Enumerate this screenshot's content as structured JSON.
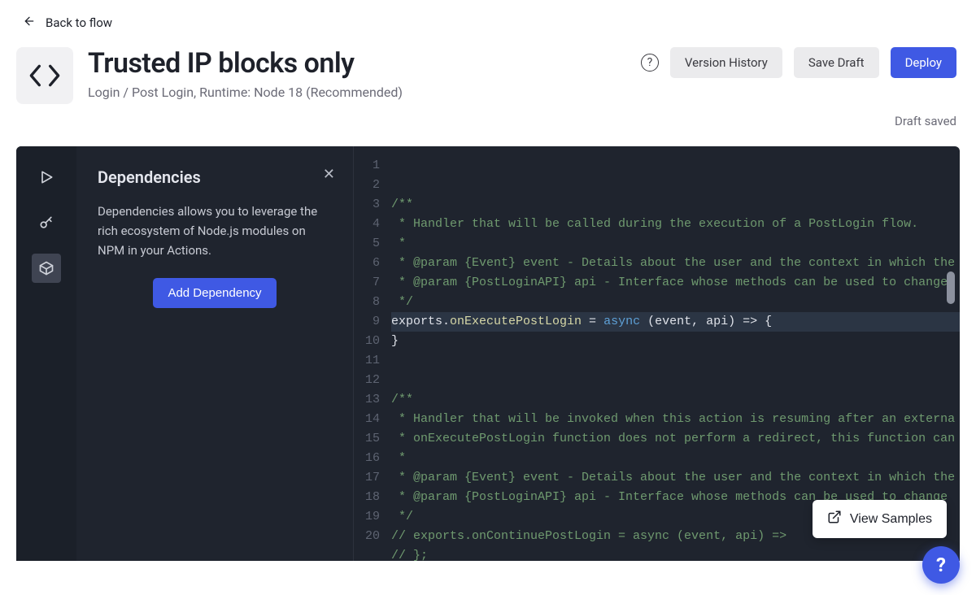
{
  "back": {
    "label": "Back to flow"
  },
  "header": {
    "title": "Trusted IP blocks only",
    "subtitle": "Login / Post Login, Runtime: Node 18 (Recommended)",
    "buttons": {
      "version_history": "Version History",
      "save_draft": "Save Draft",
      "deploy": "Deploy"
    },
    "status": "Draft saved"
  },
  "side_panel": {
    "title": "Dependencies",
    "description": "Dependencies allows you to leverage the rich ecosystem of Node.js modules on NPM in your Actions.",
    "add_button": "Add Dependency"
  },
  "rail": {
    "items": [
      {
        "name": "play",
        "active": false
      },
      {
        "name": "key",
        "active": false
      },
      {
        "name": "package",
        "active": true
      }
    ]
  },
  "code": {
    "lines": [
      [
        {
          "c": "comment",
          "t": "/**"
        }
      ],
      [
        {
          "c": "comment",
          "t": " * Handler that will be called during the execution of a PostLogin flow."
        }
      ],
      [
        {
          "c": "comment",
          "t": " *"
        }
      ],
      [
        {
          "c": "comment",
          "t": " * @param {Event} event - Details about the user and the context in which the"
        }
      ],
      [
        {
          "c": "comment",
          "t": " * @param {PostLoginAPI} api - Interface whose methods can be used to change"
        }
      ],
      [
        {
          "c": "comment",
          "t": " */"
        }
      ],
      [
        {
          "c": "plain",
          "t": "exports."
        },
        {
          "c": "fn",
          "t": "onExecutePostLogin"
        },
        {
          "c": "plain",
          "t": " = "
        },
        {
          "c": "keyword",
          "t": "async"
        },
        {
          "c": "plain",
          "t": " (event, api) => {"
        }
      ],
      [
        {
          "c": "plain",
          "t": "}"
        }
      ],
      [],
      [],
      [
        {
          "c": "comment",
          "t": "/**"
        }
      ],
      [
        {
          "c": "comment",
          "t": " * Handler that will be invoked when this action is resuming after an externa"
        }
      ],
      [
        {
          "c": "comment",
          "t": " * onExecutePostLogin function does not perform a redirect, this function can"
        }
      ],
      [
        {
          "c": "comment",
          "t": " *"
        }
      ],
      [
        {
          "c": "comment",
          "t": " * @param {Event} event - Details about the user and the context in which the"
        }
      ],
      [
        {
          "c": "comment",
          "t": " * @param {PostLoginAPI} api - Interface whose methods can be used to change"
        }
      ],
      [
        {
          "c": "comment",
          "t": " */"
        }
      ],
      [
        {
          "c": "comment",
          "t": "// exports.onContinuePostLogin = async (event, api) =>"
        }
      ],
      [
        {
          "c": "comment",
          "t": "// };"
        }
      ],
      []
    ],
    "highlight_line": 7
  },
  "view_samples": {
    "label": "View Samples"
  }
}
